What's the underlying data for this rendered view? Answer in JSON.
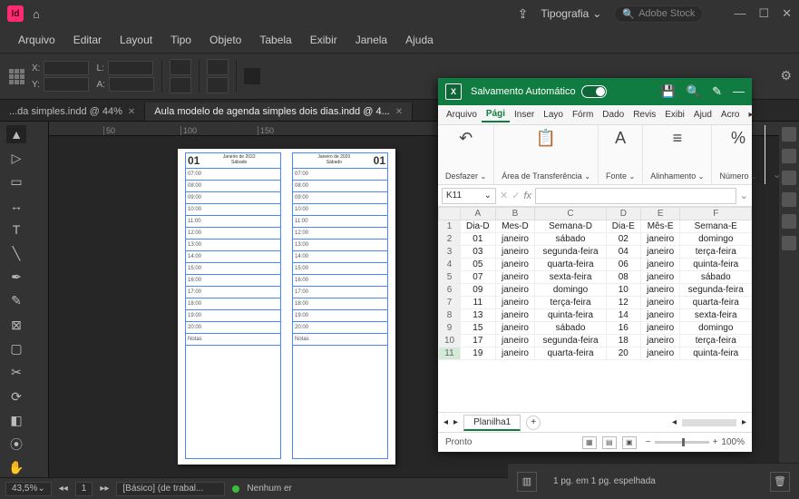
{
  "titlebar": {
    "app_abbrev": "Id",
    "workspace_dropdown": "Tipografia",
    "stock_placeholder": "Adobe Stock"
  },
  "menubar": [
    "Arquivo",
    "Editar",
    "Layout",
    "Tipo",
    "Objeto",
    "Tabela",
    "Exibir",
    "Janela",
    "Ajuda"
  ],
  "ctrlstrip": {
    "x_label": "X:",
    "y_label": "Y:",
    "l_label": "L:",
    "a_label": "A:"
  },
  "doctabs": [
    {
      "label": "...da simples.indd @ 44%",
      "active": false
    },
    {
      "label": "Aula modelo de agenda simples dois dias.indd @ 4...",
      "active": true
    }
  ],
  "ruler_ticks": [
    "50",
    "100",
    "150"
  ],
  "spread": {
    "left": {
      "daynum": "01",
      "month": "Janeiro de 2022",
      "weekday": "Sábado"
    },
    "right": {
      "daynum": "01",
      "month": "Janeiro de 2020",
      "weekday": "Sábado"
    },
    "hours": [
      "07:00",
      "08:00",
      "09:00",
      "10:00",
      "11:00",
      "12:00",
      "13:00",
      "14:00",
      "15:00",
      "16:00",
      "17:00",
      "18:00",
      "19:00",
      "20:00",
      "Notas"
    ]
  },
  "statusbar": {
    "zoom": "43,5%",
    "page": "1",
    "style": "[Básico] (de trabal...",
    "errors": "Nenhum er",
    "pageinfo": "1 pg. em 1 pg. espelhada"
  },
  "excel": {
    "autosave_label": "Salvamento Automático",
    "menus": [
      "Arquivo",
      "Pági",
      "Inser",
      "Layo",
      "Fórm",
      "Dado",
      "Revis",
      "Exibi",
      "Ajud",
      "Acro"
    ],
    "active_menu": 1,
    "ribbon": [
      {
        "icon": "↶",
        "label": "Desfazer"
      },
      {
        "icon": "📋",
        "label": "Área de Transferência"
      },
      {
        "icon": "A",
        "label": "Fonte"
      },
      {
        "icon": "≡",
        "label": "Alinhamento"
      },
      {
        "icon": "%",
        "label": "Número"
      }
    ],
    "namebox": "K11",
    "columns": [
      "A",
      "B",
      "C",
      "D",
      "E",
      "F"
    ],
    "headers_row": [
      "Dia-D",
      "Mes-D",
      "Semana-D",
      "Dia-E",
      "Mês-E",
      "Semana-E"
    ],
    "rows": [
      [
        "01",
        "janeiro",
        "sábado",
        "02",
        "janeiro",
        "domingo"
      ],
      [
        "03",
        "janeiro",
        "segunda-feira",
        "04",
        "janeiro",
        "terça-feira"
      ],
      [
        "05",
        "janeiro",
        "quarta-feira",
        "06",
        "janeiro",
        "quinta-feira"
      ],
      [
        "07",
        "janeiro",
        "sexta-feira",
        "08",
        "janeiro",
        "sábado"
      ],
      [
        "09",
        "janeiro",
        "domingo",
        "10",
        "janeiro",
        "segunda-feira"
      ],
      [
        "11",
        "janeiro",
        "terça-feira",
        "12",
        "janeiro",
        "quarta-feira"
      ],
      [
        "13",
        "janeiro",
        "quinta-feira",
        "14",
        "janeiro",
        "sexta-feira"
      ],
      [
        "15",
        "janeiro",
        "sábado",
        "16",
        "janeiro",
        "domingo"
      ],
      [
        "17",
        "janeiro",
        "segunda-feira",
        "18",
        "janeiro",
        "terça-feira"
      ],
      [
        "19",
        "janeiro",
        "quarta-feira",
        "20",
        "janeiro",
        "quinta-feira"
      ]
    ],
    "sheet_name": "Planilha1",
    "status_ready": "Pronto",
    "zoom_pct": "100%"
  }
}
